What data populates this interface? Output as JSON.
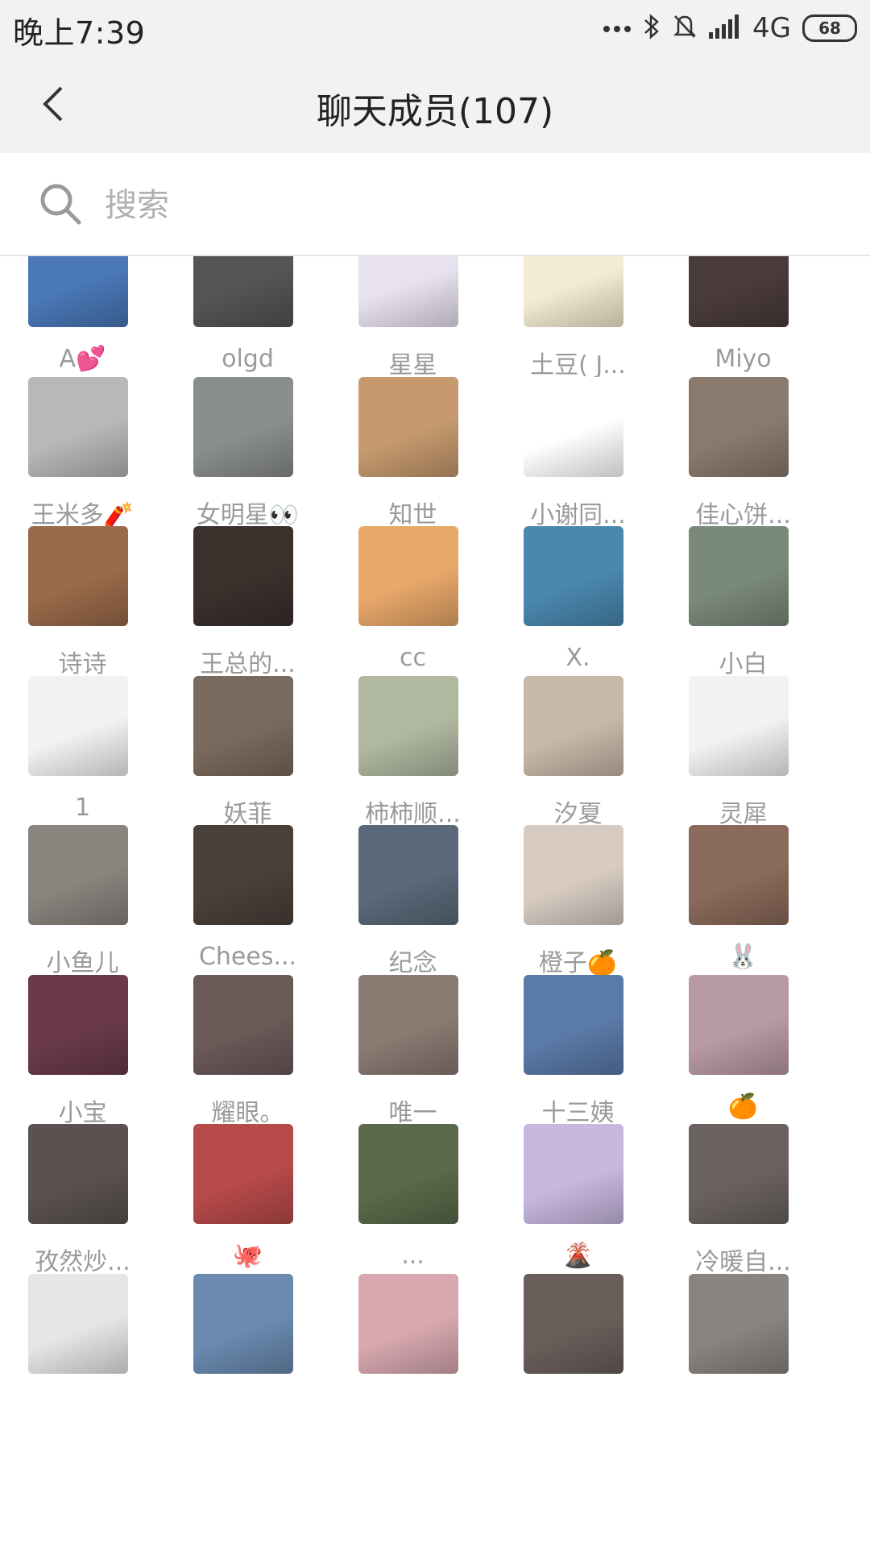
{
  "status_bar": {
    "time": "晚上7:39",
    "network": "4G",
    "battery": "68"
  },
  "header": {
    "title": "聊天成员(107)"
  },
  "search": {
    "placeholder": "搜索"
  },
  "members": [
    [
      {
        "name": "A💕",
        "color": "#4a78b8"
      },
      {
        "name": "olgd",
        "color": "#555555"
      },
      {
        "name": "星星",
        "color": "#e8e2f0"
      },
      {
        "name": "土豆( J...",
        "color": "#f4ecd2"
      },
      {
        "name": "Miyo",
        "color": "#4a3c3a"
      }
    ],
    [
      {
        "name": "王米多🧨",
        "color": "#b8b8b8"
      },
      {
        "name": "女明星👀",
        "color": "#8a8e8c"
      },
      {
        "name": "知世",
        "color": "#c69a6e"
      },
      {
        "name": "小谢同...",
        "color": "#ffffff"
      },
      {
        "name": "佳心饼...",
        "color": "#8a7a6e"
      }
    ],
    [
      {
        "name": "诗诗",
        "color": "#9a6a4a"
      },
      {
        "name": "王总的...",
        "color": "#3a302c"
      },
      {
        "name": "cc",
        "color": "#e8a86a"
      },
      {
        "name": "X.",
        "color": "#4a88b0"
      },
      {
        "name": "小白",
        "color": "#7a8a7a"
      }
    ],
    [
      {
        "name": "1",
        "color": "#f4f2f0"
      },
      {
        "name": "妖菲",
        "color": "#7a6a5e"
      },
      {
        "name": "柿柿顺...",
        "color": "#b0b8a0"
      },
      {
        "name": "汐夏",
        "color": "#c8b8a8"
      },
      {
        "name": "灵犀",
        "color": "#f2f2f2"
      }
    ],
    [
      {
        "name": "小鱼儿",
        "color": "#8a847e"
      },
      {
        "name": "Chees...",
        "color": "#4a403a"
      },
      {
        "name": "纪念",
        "color": "#5a6a7a"
      },
      {
        "name": "橙子🍊",
        "color": "#d8ccc2"
      },
      {
        "name": "🐰",
        "color": "#8a6a5a"
      }
    ],
    [
      {
        "name": "小宝",
        "color": "#6a3a4a"
      },
      {
        "name": "耀眼。",
        "color": "#6a5a58"
      },
      {
        "name": "唯一",
        "color": "#8a7a72"
      },
      {
        "name": "十三姨",
        "color": "#5a7aa8"
      },
      {
        "name": "🍊",
        "color": "#b89aa2"
      }
    ],
    [
      {
        "name": "孜然炒...",
        "color": "#5a5250"
      },
      {
        "name": "🐙",
        "color": "#b84a4a"
      },
      {
        "name": "...",
        "color": "#5a6a4a"
      },
      {
        "name": "🌋",
        "color": "#c8b8e0"
      },
      {
        "name": "冷暖自...",
        "color": "#6a625e"
      }
    ],
    [
      {
        "name": "",
        "color": "#e8e6e4"
      },
      {
        "name": "",
        "color": "#6a8ab0"
      },
      {
        "name": "",
        "color": "#d8a8b0"
      },
      {
        "name": "",
        "color": "#6a5e5a"
      },
      {
        "name": "",
        "color": "#8a8480"
      }
    ]
  ]
}
